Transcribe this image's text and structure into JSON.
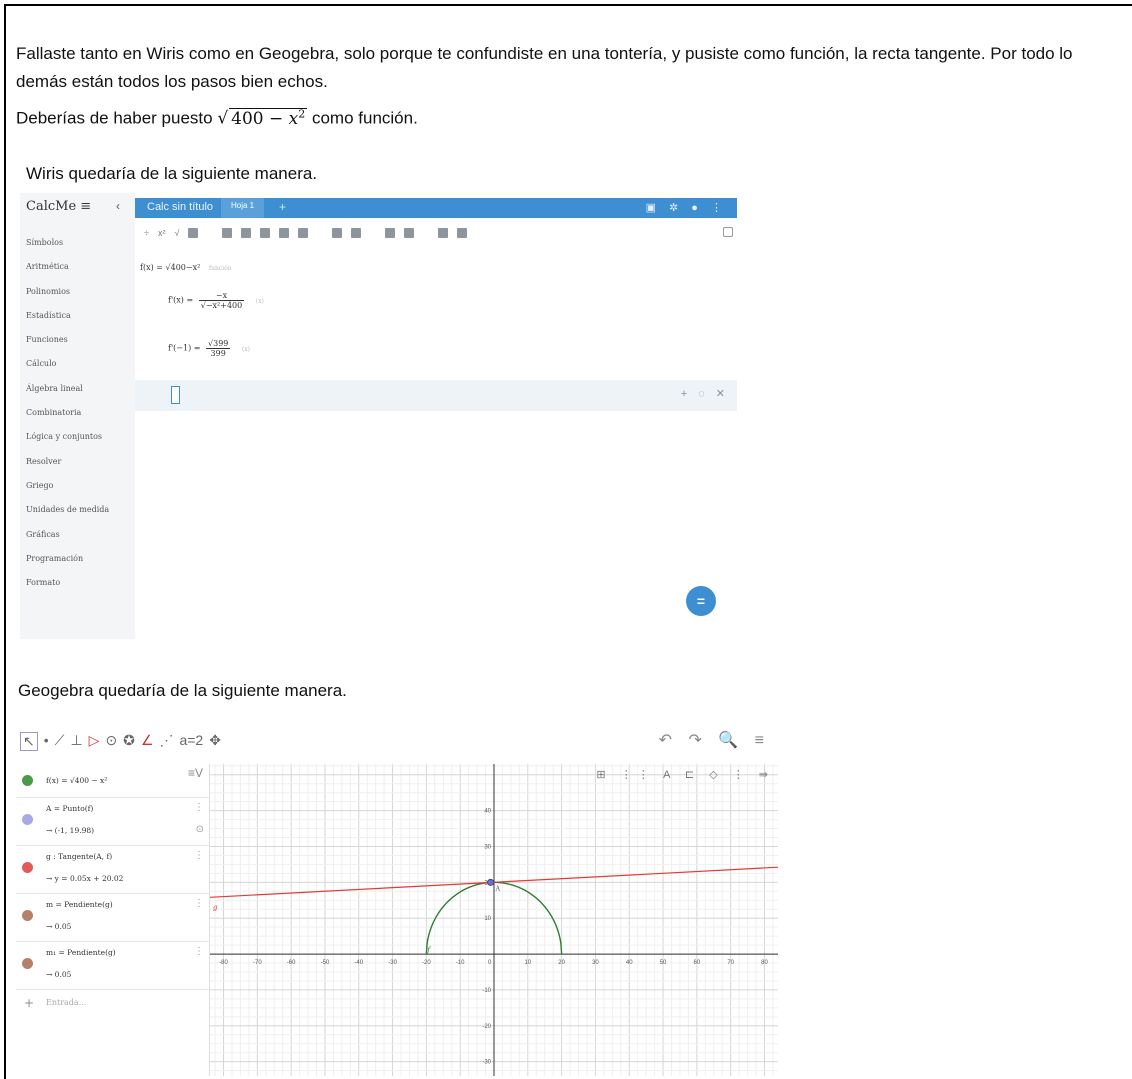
{
  "text": {
    "line1": "Fallaste tanto en Wiris como en Geogebra, solo porque te confundiste en una tontería, y pusiste como función, la recta tangente. Por todo lo",
    "line2": "demás están todos los pasos bien echos.",
    "line3_before": "Deberías de haber puesto ",
    "line3_radicand_num": "400 − ",
    "line3_radicand_var": "x",
    "line3_radicand_exp": "2",
    "line3_after": " como función.",
    "wiris_heading": "Wiris quedaría de la siguiente manera.",
    "geogebra_heading": "Geogebra quedaría de la siguiente manera."
  },
  "calcme": {
    "logo": "CalcMe ≡",
    "collapse": "‹",
    "title": "Calc sin título",
    "tab": "Hoja 1",
    "add_tab": "+",
    "menu": [
      "Símbolos",
      "Aritmética",
      "Polinomios",
      "Estadística",
      "Funciones",
      "Cálculo",
      "Álgebra lineal",
      "Combinatoria",
      "Lógica y conjuntos",
      "Resolver",
      "Griego",
      "Unidades de medida",
      "Gráficas",
      "Programación",
      "Formato"
    ],
    "line_f_lhs": "f(x)  =",
    "line_f_rhs": "√400−x²",
    "line_f_hint": "función",
    "line_fp_lhs": "f'(x)  =",
    "line_fp_num": "−x",
    "line_fp_den": "√−x²+400",
    "line_fp_hint": "(x)",
    "line_fpv_lhs": "f'(−1)  =",
    "line_fpv_num": "√399",
    "line_fpv_den": "399",
    "line_fpv_hint": "(x)",
    "row_actions": "+ ◌ ✕",
    "eval_button": "="
  },
  "geogebra": {
    "tools": [
      "↖",
      "•",
      "⟋",
      "⊥",
      "▷",
      "⊙",
      "✪",
      "∠",
      "⋰",
      "a=2",
      "✥"
    ],
    "right_icons": "↶ ↷ 🔍 ≡",
    "style_bar": "⊞ ⋮⋮ A ⊏ ◇ ⋮ ⇛",
    "algebra_menu": "≡V",
    "items": [
      {
        "def": "f(x) = √400 − x²",
        "val": "",
        "color": "#4a9a48"
      },
      {
        "def": "A = Punto(f)",
        "val": "→ (-1, 19.98)",
        "color": "#a9a8e8"
      },
      {
        "def": "g : Tangente(A, f)",
        "val": "→ y = 0.05x + 20.02",
        "color": "#e25a5a"
      },
      {
        "def": "m = Pendiente(g)",
        "val": "→ 0.05",
        "color": "#b5806a"
      },
      {
        "def": "m₁ = Pendiente(g)",
        "val": "→ 0.05",
        "color": "#b5806a"
      }
    ],
    "input_placeholder": "Entrada...",
    "input_plus": "+",
    "radius": 20,
    "tangent": {
      "slope": 0.05,
      "intercept": 20.02
    },
    "point": [
      -1,
      19.98
    ],
    "x_ticks": [
      -80,
      -70,
      -60,
      -50,
      -40,
      -30,
      -20,
      -10,
      0,
      10,
      20,
      30,
      40,
      50,
      60,
      70,
      80
    ],
    "y_ticks": [
      40,
      30,
      20,
      10,
      -10,
      -20,
      -30
    ],
    "labels": {
      "curve": "f",
      "line": "g",
      "point": "A"
    },
    "xlim": [
      -84,
      84
    ],
    "ylim": [
      -34,
      53
    ]
  }
}
